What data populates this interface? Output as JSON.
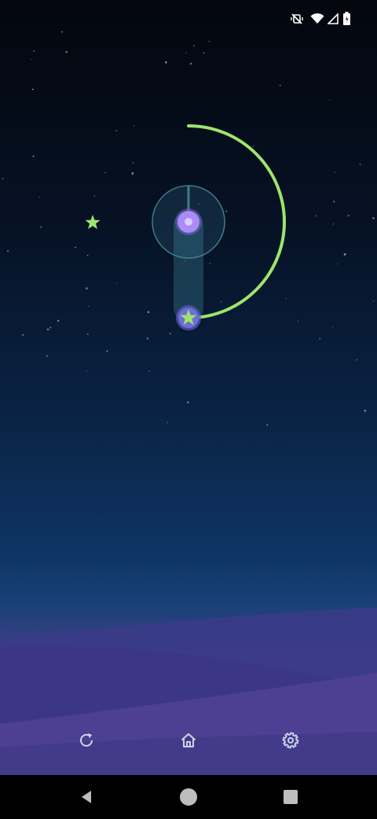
{
  "status_bar": {
    "icons": [
      "mute-vibrate-icon",
      "wifi-icon",
      "signal-icon",
      "battery-icon"
    ]
  },
  "game": {
    "colors": {
      "accent_green": "#9de56c",
      "orb_purple": "#a98cf5",
      "track_teal": "#3f7d8a",
      "star_color": "#9de56c"
    },
    "arc_sweep_degrees": 180
  },
  "controls": {
    "icons": [
      "restart-icon",
      "home-icon",
      "settings-icon"
    ]
  },
  "nav_bar": {
    "icons": [
      "back-icon",
      "home-circle-icon",
      "recents-icon"
    ]
  }
}
